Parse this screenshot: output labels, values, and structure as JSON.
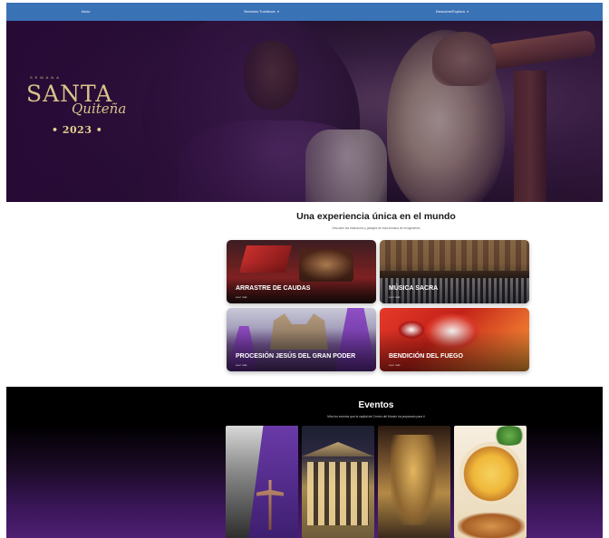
{
  "nav": {
    "items": [
      {
        "label": "Inicio",
        "has_caret": false
      },
      {
        "label": "Servicios Turísticos",
        "has_caret": true
      },
      {
        "label": "Descubre/Explora",
        "has_caret": true
      }
    ],
    "bg_color": "#3a72b6"
  },
  "hero": {
    "logo": {
      "top": "SEMANA",
      "main": "SANTA",
      "script": "Quiteña",
      "year": "• 2023 •"
    }
  },
  "experience": {
    "title": "Una experiencia única en el mundo",
    "subtitle": "Descubre las tradiciones y paisajes de esta semana de recogimiento",
    "cards": [
      {
        "title": "ARRASTRE DE CAUDAS",
        "link": "Leer más"
      },
      {
        "title": "MÚSICA SACRA",
        "link": "Leer más"
      },
      {
        "title": "PROCESIÓN JESÚS DEL GRAN PODER",
        "link": "Leer más"
      },
      {
        "title": "BENDICIÓN DEL FUEGO",
        "link": "Leer más"
      }
    ]
  },
  "events": {
    "title": "Eventos",
    "subtitle": "Mira los eventos que la capital del Centro del Mundo ha preparado para ti",
    "cards": [
      {
        "icon": "procession-photo"
      },
      {
        "icon": "theater-photo"
      },
      {
        "icon": "church-altar-photo"
      },
      {
        "icon": "fanesca-dish-photo"
      }
    ]
  }
}
